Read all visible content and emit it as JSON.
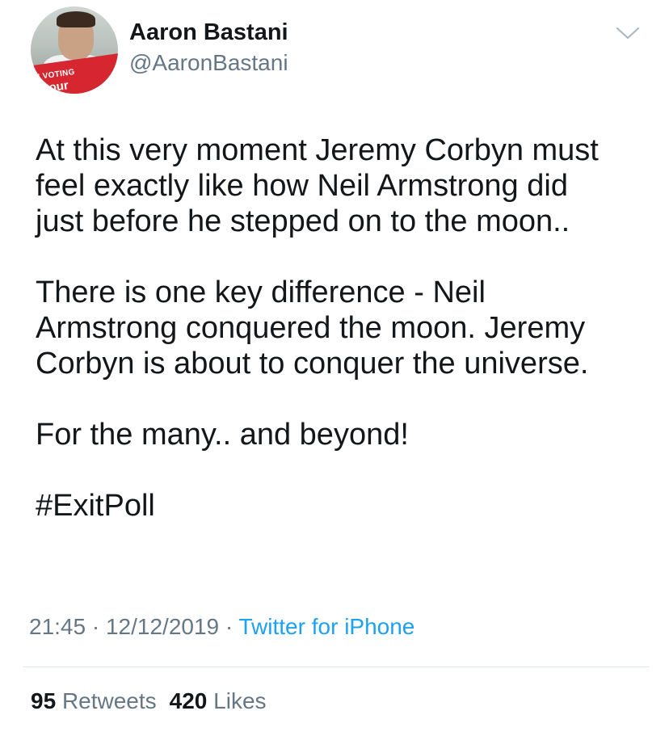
{
  "user": {
    "name": "Aaron Bastani",
    "handle": "@AaronBastani",
    "avatar_badge_line1": "M VOTING",
    "avatar_badge_line2": "abour"
  },
  "tweet": {
    "paragraphs": [
      [
        "At this very moment Jeremy Corbyn must",
        "feel exactly like how Neil Armstrong did",
        "just before he stepped on to the moon.."
      ],
      [
        "There is one key difference - Neil",
        "Armstrong conquered the moon. Jeremy",
        "Corbyn is about to conquer the universe."
      ],
      [
        "For the many.. and beyond!"
      ],
      [
        "#ExitPoll"
      ]
    ]
  },
  "meta": {
    "time": "21:45",
    "separator": "·",
    "date": "12/12/2019",
    "source": "Twitter for iPhone"
  },
  "stats": {
    "retweets_count": "95",
    "retweets_label": "Retweets",
    "likes_count": "420",
    "likes_label": "Likes"
  },
  "icons": {
    "chevron": "chevron-down-icon"
  },
  "colors": {
    "text": "#14171a",
    "secondary": "#657786",
    "link": "#1da1f2",
    "divider": "#e1e8ed",
    "badge": "#d6262f"
  }
}
